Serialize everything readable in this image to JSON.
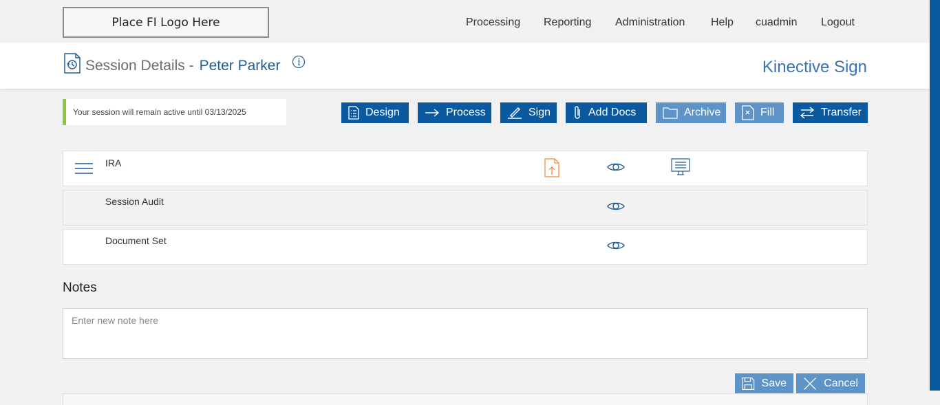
{
  "header": {
    "logo_text": "Place FI Logo Here",
    "nav": [
      "Processing",
      "Reporting",
      "Administration",
      "Help",
      "cuadmin",
      "Logout"
    ]
  },
  "title_bar": {
    "title": "Session Details -",
    "customer_name": "Peter Parker",
    "brand": "Kinective Sign"
  },
  "session_note": "Your session will remain active until 03/13/2025",
  "toolbar": {
    "design": "Design",
    "process": "Process",
    "sign": "Sign",
    "add_docs": "Add Docs",
    "archive": "Archive",
    "fill": "Fill",
    "transfer": "Transfer"
  },
  "documents": [
    {
      "label": "IRA"
    },
    {
      "label": "Session Audit"
    },
    {
      "label": "Document Set"
    }
  ],
  "notes": {
    "heading": "Notes",
    "placeholder": "Enter new note here",
    "save": "Save",
    "cancel": "Cancel"
  },
  "colors": {
    "primary": "#0b5aa0",
    "disabled": "#5e93c8",
    "accent_green": "#8cc63f",
    "upload_orange": "#f0883a"
  },
  "icons": [
    "history-icon",
    "info-icon",
    "list-icon",
    "arrow-right-icon",
    "signature-icon",
    "paperclip-icon",
    "folder-icon",
    "file-x-icon",
    "transfer-icon",
    "menu-icon",
    "upload-file-icon",
    "eye-icon",
    "presentation-icon",
    "save-icon",
    "close-icon"
  ]
}
